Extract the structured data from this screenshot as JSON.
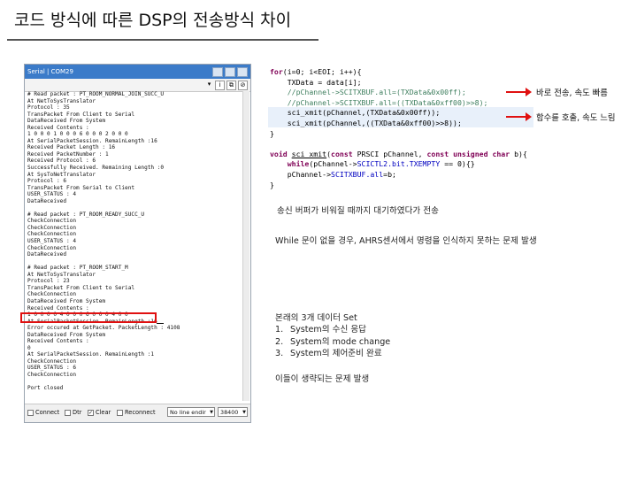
{
  "slide": {
    "title": "코드 방식에 따른 DSP의 전송방식 차이"
  },
  "serial_window": {
    "title": "Serial | COM29",
    "toolbar": {
      "dropdown_glyph": "▾",
      "info_glyph": "i",
      "copy_glyph": "⧉",
      "clear_glyph": "⊘"
    },
    "log_lines": [
      "# Read packet : PT_ROOM_NORMAL_JOIN_SUCC_U",
      "At NetToSysTranslator",
      "Protocol : 35",
      "TransPacket From Client to Serial",
      "DataReceived From System",
      "Received Contents :",
      "1 0 0 0 1 0 0 0 6 0 0 0 2 0 0 0",
      "At SerialPacketSession. RemainLength :16",
      "Received Packet Length : 16",
      "Received PacketNumber : 1",
      "Received Protocol : 6",
      "Successfully Received. Remaining Length :0",
      "At SysToNetTranslator",
      "Protocol : 6",
      "TransPacket From Serial to Client",
      "USER_STATUS : 4",
      "DataReceived",
      "",
      "# Read packet : PT_ROOM_READY_SUCC_U",
      "CheckConnection",
      "CheckConnection",
      "CheckConnection",
      "USER_STATUS : 4",
      "CheckConnection",
      "DataReceived",
      "",
      "# Read packet : PT_ROOM_START_M",
      "At NetToSysTranslator",
      "Protocol : 23",
      "TransPacket From Client to Serial",
      "CheckConnection",
      "DataReceived From System",
      "Received Contents :",
      "1 0 0 0 0 4 0 0 0 6 0 0 0 4 0 0",
      "At SerialPacketSession. RemainLength :16",
      "Error occured at GetPacket. PacketLength : 4108",
      "DataReceived From System",
      "Received Contents :",
      "0",
      "At SerialPacketSession. RemainLength :1",
      "CheckConnection",
      "USER_STATUS : 6",
      "CheckConnection",
      "",
      "Port closed"
    ],
    "footer": {
      "connect_label": "Connect",
      "dtr_label": "Dtr",
      "clear_label": "Clear",
      "reconnect_label": "Reconnect",
      "line_ending": "No line endir",
      "baud": "38400"
    }
  },
  "code": {
    "l1_kw": "for",
    "l1_rest": "(i=0; i<EOI; i++){",
    "l2": "    TXData = data[i];",
    "l3": "    //pChannel->SCITXBUF.all=(TXData&0x00ff);",
    "l4": "    //pChannel->SCITXBUF.all=((TXData&0xff00)>>8);",
    "l5_fn": "sci_xmit",
    "l5_rest": "(pChannel,(TXData&0x00ff));",
    "l6_fn": "sci_xmit",
    "l6_rest": "(pChannel,((TXData&0xff00)>>8));",
    "l7": "}",
    "l8_kw1": "void",
    "l8_fn": "sci_xmit",
    "l8_p1": "(",
    "l8_kw2": "const",
    "l8_p2": " PRSCI pChannel, ",
    "l8_kw3": "const unsigned char",
    "l8_p3": " b){",
    "l9_kw": "while",
    "l9_p1": "(pChannel->",
    "l9_f": "SCICTL2.bit.TXEMPTY",
    "l9_p2": " == 0){}",
    "l10_p1": "    pChannel->",
    "l10_f": "SCITXBUF.all",
    "l10_p2": "=b;",
    "l11": "}"
  },
  "annotations": {
    "fast": "바로 전송, 속도 빠름",
    "slow": "함수를 호출, 속도 느림"
  },
  "notes": {
    "n1": "송신 버퍼가 비워질 때까지 대기하였다가 전송",
    "n2": "While 문이 없을 경우, AHRS센서에서 명령을 인식하지 못하는 문제 발생",
    "list_title": "본래의 3개 데이터 Set",
    "items": [
      {
        "num": "1.",
        "text": "System의 수신 응답"
      },
      {
        "num": "2.",
        "text": "System의 mode change"
      },
      {
        "num": "3.",
        "text": "System의 제어준비 완료"
      }
    ],
    "n3": "이들이 생략되는 문제 발생"
  }
}
